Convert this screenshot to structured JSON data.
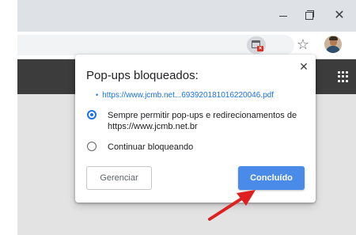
{
  "window_controls": {
    "minimize_icon": "minimize-icon",
    "maximize_icon": "maximize-icon",
    "close_icon": "close-icon",
    "close_glyph": "✕"
  },
  "toolbar": {
    "popup_blocked_icon": "popup-blocked-icon",
    "star_glyph": "☆",
    "avatar": "profile-avatar"
  },
  "popup": {
    "title": "Pop-ups bloqueados:",
    "close_glyph": "✕",
    "blocked_links": [
      "https://www.jcmb.net...693920181016220046.pdf"
    ],
    "options": {
      "allow_label": "Sempre permitir pop-ups e redirecionamentos de https://www.jcmb.net.br",
      "block_label": "Continuar bloqueando",
      "selected": "allow"
    },
    "buttons": {
      "manage": "Gerenciar",
      "done": "Concluído"
    }
  },
  "colors": {
    "accent": "#1a73e8",
    "done_button": "#4a8ae8",
    "navbar": "#3c3c3c",
    "arrow": "#e02020"
  }
}
